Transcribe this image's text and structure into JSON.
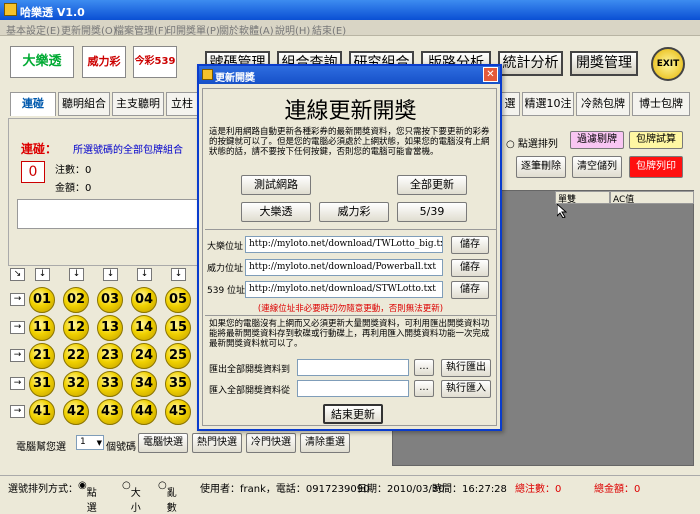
{
  "window": {
    "title": "哈樂透 V1.0"
  },
  "menu": [
    "基本設定(E)",
    "更新開獎(O)",
    "檔案管理(F)",
    "印開獎單(P)",
    "關於軟體(A)",
    "說明(H)",
    "結束(E)"
  ],
  "logos": {
    "lotto": "大樂透",
    "lotto_num": "6/49",
    "powerball": "威力彩",
    "five39": "今彩539"
  },
  "toolbar": {
    "btn1": "號碼管理",
    "btn2": "組合查詢",
    "btn3": "研究組合",
    "btn4": "版路分析",
    "stats": "統計分析",
    "manage": "開獎管理",
    "exit": "EXIT"
  },
  "tabs": [
    "連碰",
    "聽明組合",
    "主支聽明",
    "立柱",
    "選",
    "精選10注",
    "冷熱包牌",
    "博士包牌"
  ],
  "left": {
    "label": "連碰：",
    "hint": "所選號碼的全部包牌組合",
    "count": "0",
    "bets_label": "注數：0",
    "amount_label": "金額：0"
  },
  "balls": [
    "01",
    "02",
    "03",
    "04",
    "05",
    "11",
    "12",
    "13",
    "14",
    "15",
    "21",
    "22",
    "23",
    "24",
    "25",
    "31",
    "32",
    "33",
    "34",
    "35",
    "41",
    "42",
    "43",
    "44",
    "45"
  ],
  "bottom_left": {
    "auto_label": "電腦幫您選",
    "select": "1",
    "unit": "個號碼",
    "btn_auto": "電腦快選",
    "btn_hot": "熱門快選",
    "btn_cold": "冷門快選",
    "btn_clear": "清除重選"
  },
  "right": {
    "radio": "點選排列",
    "filter_btn": "過濾剔牌",
    "pack_btn": "包牌試算",
    "del_btn": "逐筆刪除",
    "clear_btn": "清空儲列",
    "print_btn": "包牌列印",
    "col1": "單雙",
    "col2": "AC值"
  },
  "status": {
    "sort_label": "選號排列方式：",
    "opt1": "點選",
    "opt2": "大小",
    "opt3": "亂數",
    "user": "使用者：frank，電話：0917239090",
    "date": "日期：2010/03/30",
    "time": "時間：16:27:28",
    "total_bets": "總注數：0",
    "total_amount": "總金額：0"
  },
  "dialog": {
    "title": "更新開獎",
    "heading": "連線更新開獎",
    "intro": "這是利用網路自動更新各種彩券的最新開獎資料，您只需按下要更新的彩券的按鍵就可以了。但是您的電腦必須處於上網狀態，如果您的電腦沒有上網狀態的話，請不要按下任何按鍵，否則您的電腦可能會當機。",
    "btn_test": "測試網路",
    "btn_all": "全部更新",
    "btn_lotto": "大樂透",
    "btn_power": "威力彩",
    "btn_539": "5/39",
    "url_lotto_label": "大樂位址",
    "url_lotto": "http://myloto.net/download/TWLotto_big.txt",
    "url_power_label": "威力位址",
    "url_power": "http://myloto.net/download/Powerball.txt",
    "url_539_label": "539 位址",
    "url_539": "http://myloto.net/download/STWLotto.txt",
    "save": "儲存",
    "warning": "(連線位址非必要時切勿隨意更動，否則無法更新)",
    "offline": "如果您的電腦沒有上網而又必須更新大量開獎資料，可利用匯出開獎資料功能將最新開獎資料存到軟碟或行動碟上，再利用匯入開獎資料功能一次完成最新開獎資料就可以了。",
    "export_label": "匯出全部開獎資料到",
    "import_label": "匯入全部開獎資料從",
    "browse": "...",
    "export_btn": "執行匯出",
    "import_btn": "執行匯入",
    "finish": "結束更新"
  }
}
